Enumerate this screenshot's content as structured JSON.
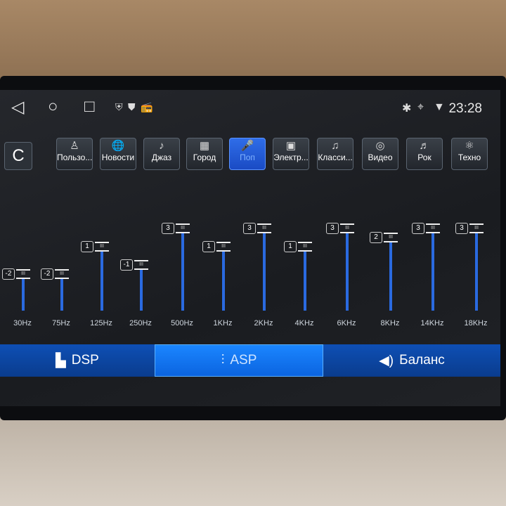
{
  "status": {
    "time": "23:28",
    "icons": [
      "bluetooth-icon",
      "location-icon",
      "wifi-icon"
    ],
    "left_icons": [
      "shield-x-icon",
      "shield-play-icon",
      "radio-icon"
    ]
  },
  "nav": {
    "back": "◁",
    "home": "○",
    "recents": "□"
  },
  "presets": {
    "reset_icon": "C",
    "items": [
      {
        "label": "Пользо...",
        "icon": "♙"
      },
      {
        "label": "Новости",
        "icon": "🌐"
      },
      {
        "label": "Джаз",
        "icon": "♪"
      },
      {
        "label": "Город",
        "icon": "▦"
      },
      {
        "label": "Поп",
        "icon": "🎤",
        "active": true
      },
      {
        "label": "Электр...",
        "icon": "▣"
      },
      {
        "label": "Класси...",
        "icon": "♫"
      },
      {
        "label": "Видео",
        "icon": "◎"
      },
      {
        "label": "Рок",
        "icon": "♬"
      },
      {
        "label": "Техно",
        "icon": "⚛"
      }
    ]
  },
  "equalizer": {
    "bands": [
      {
        "freq": "30Hz",
        "value": -2
      },
      {
        "freq": "75Hz",
        "value": -2
      },
      {
        "freq": "125Hz",
        "value": 1
      },
      {
        "freq": "250Hz",
        "value": -1
      },
      {
        "freq": "500Hz",
        "value": 3
      },
      {
        "freq": "1KHz",
        "value": 1
      },
      {
        "freq": "2KHz",
        "value": 3
      },
      {
        "freq": "4KHz",
        "value": 1
      },
      {
        "freq": "6KHz",
        "value": 3
      },
      {
        "freq": "8KHz",
        "value": 2
      },
      {
        "freq": "14KHz",
        "value": 3
      },
      {
        "freq": "18KHz",
        "value": 3
      }
    ],
    "accent": "#2a6ae0"
  },
  "tabs": [
    {
      "label": "DSP",
      "icon": "▙"
    },
    {
      "label": "ASP",
      "icon": "⫶",
      "active": true
    },
    {
      "label": "Баланс",
      "icon": "◀)"
    }
  ]
}
